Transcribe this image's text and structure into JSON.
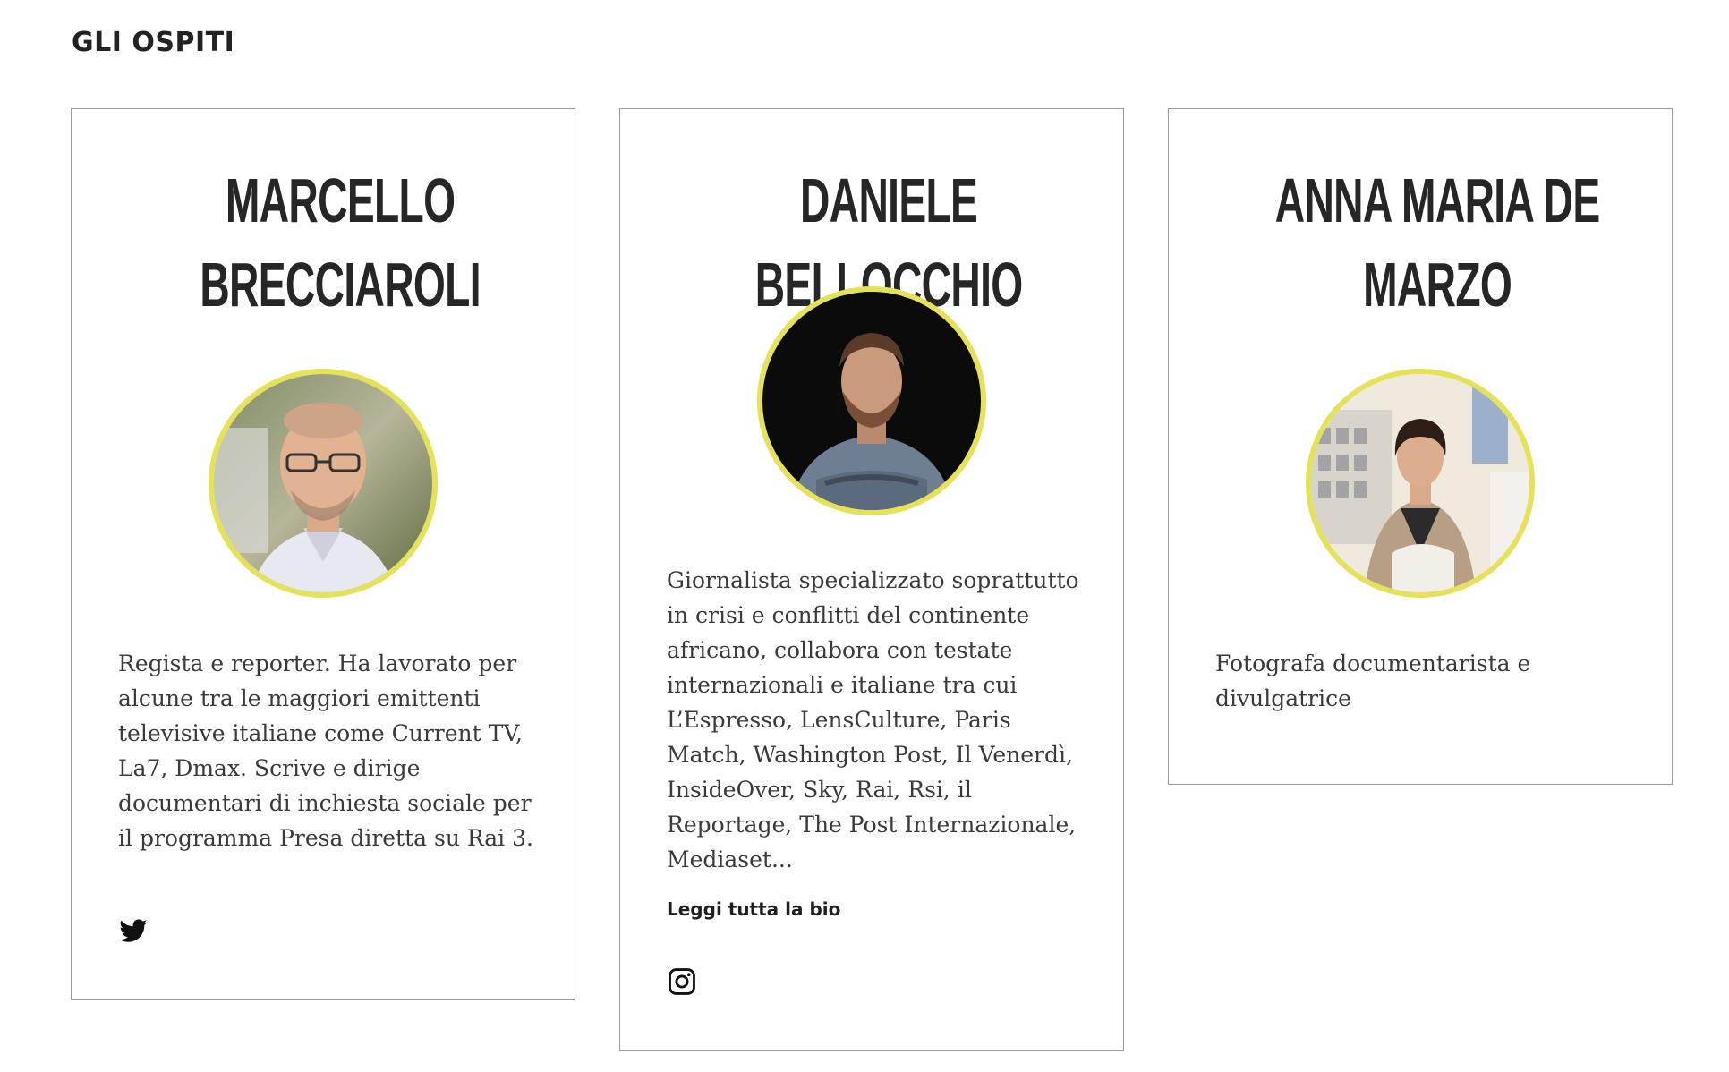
{
  "section": {
    "title": "GLI OSPITI"
  },
  "colors": {
    "avatar_ring": "#e5e25a",
    "card_border": "#9a9a9a",
    "text": "#3a3a3a"
  },
  "guests": [
    {
      "name": "MARCELLO BRECCIAROLI",
      "bio": "Regista e reporter. Ha lavorato per alcune tra le maggiori emittenti televisive  italiane come Current TV, La7, Dmax. Scrive e dirige documentari di inchiesta  sociale per il programma Presa diretta su Rai 3.",
      "social_icon": "twitter-icon"
    },
    {
      "name": "DANIELE BELLOCCHIO",
      "bio": "Giornalista specializzato soprattutto in crisi e conflitti del continente africano,  collabora con testate internazionali e italiane tra cui L’Espresso, LensCulture, Paris Match, Washington Post, Il Venerdì, InsideOver, Sky, Rai, Rsi, il Reportage, The Post Internazionale, Mediaset...",
      "read_more": "Leggi tutta la bio",
      "social_icon": "instagram-icon"
    },
    {
      "name": "ANNA MARIA DE MARZO",
      "bio": "Fotografa documentarista e divulgatrice"
    }
  ]
}
